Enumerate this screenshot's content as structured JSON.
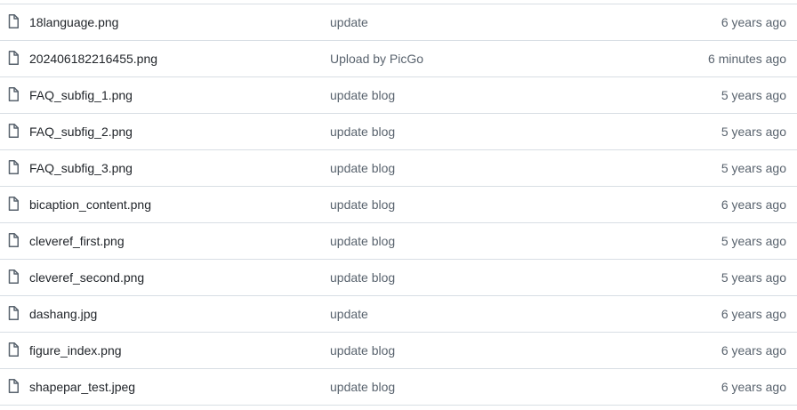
{
  "files": [
    {
      "icon": "file-icon",
      "name": "18language.png",
      "message": "update",
      "age": "6 years ago"
    },
    {
      "icon": "file-icon",
      "name": "202406182216455.png",
      "message": "Upload by PicGo",
      "age": "6 minutes ago"
    },
    {
      "icon": "file-icon",
      "name": "FAQ_subfig_1.png",
      "message": "update blog",
      "age": "5 years ago"
    },
    {
      "icon": "file-icon",
      "name": "FAQ_subfig_2.png",
      "message": "update blog",
      "age": "5 years ago"
    },
    {
      "icon": "file-icon",
      "name": "FAQ_subfig_3.png",
      "message": "update blog",
      "age": "5 years ago"
    },
    {
      "icon": "file-icon",
      "name": "bicaption_content.png",
      "message": "update blog",
      "age": "6 years ago"
    },
    {
      "icon": "file-icon",
      "name": "cleveref_first.png",
      "message": "update blog",
      "age": "5 years ago"
    },
    {
      "icon": "file-icon",
      "name": "cleveref_second.png",
      "message": "update blog",
      "age": "5 years ago"
    },
    {
      "icon": "file-icon",
      "name": "dashang.jpg",
      "message": "update",
      "age": "6 years ago"
    },
    {
      "icon": "file-icon",
      "name": "figure_index.png",
      "message": "update blog",
      "age": "6 years ago"
    },
    {
      "icon": "file-icon",
      "name": "shapepar_test.jpeg",
      "message": "update blog",
      "age": "6 years ago"
    }
  ],
  "colors": {
    "border": "#d8dee4",
    "name_text": "#1f2328",
    "muted_text": "#59636e",
    "icon": "#59636e"
  }
}
